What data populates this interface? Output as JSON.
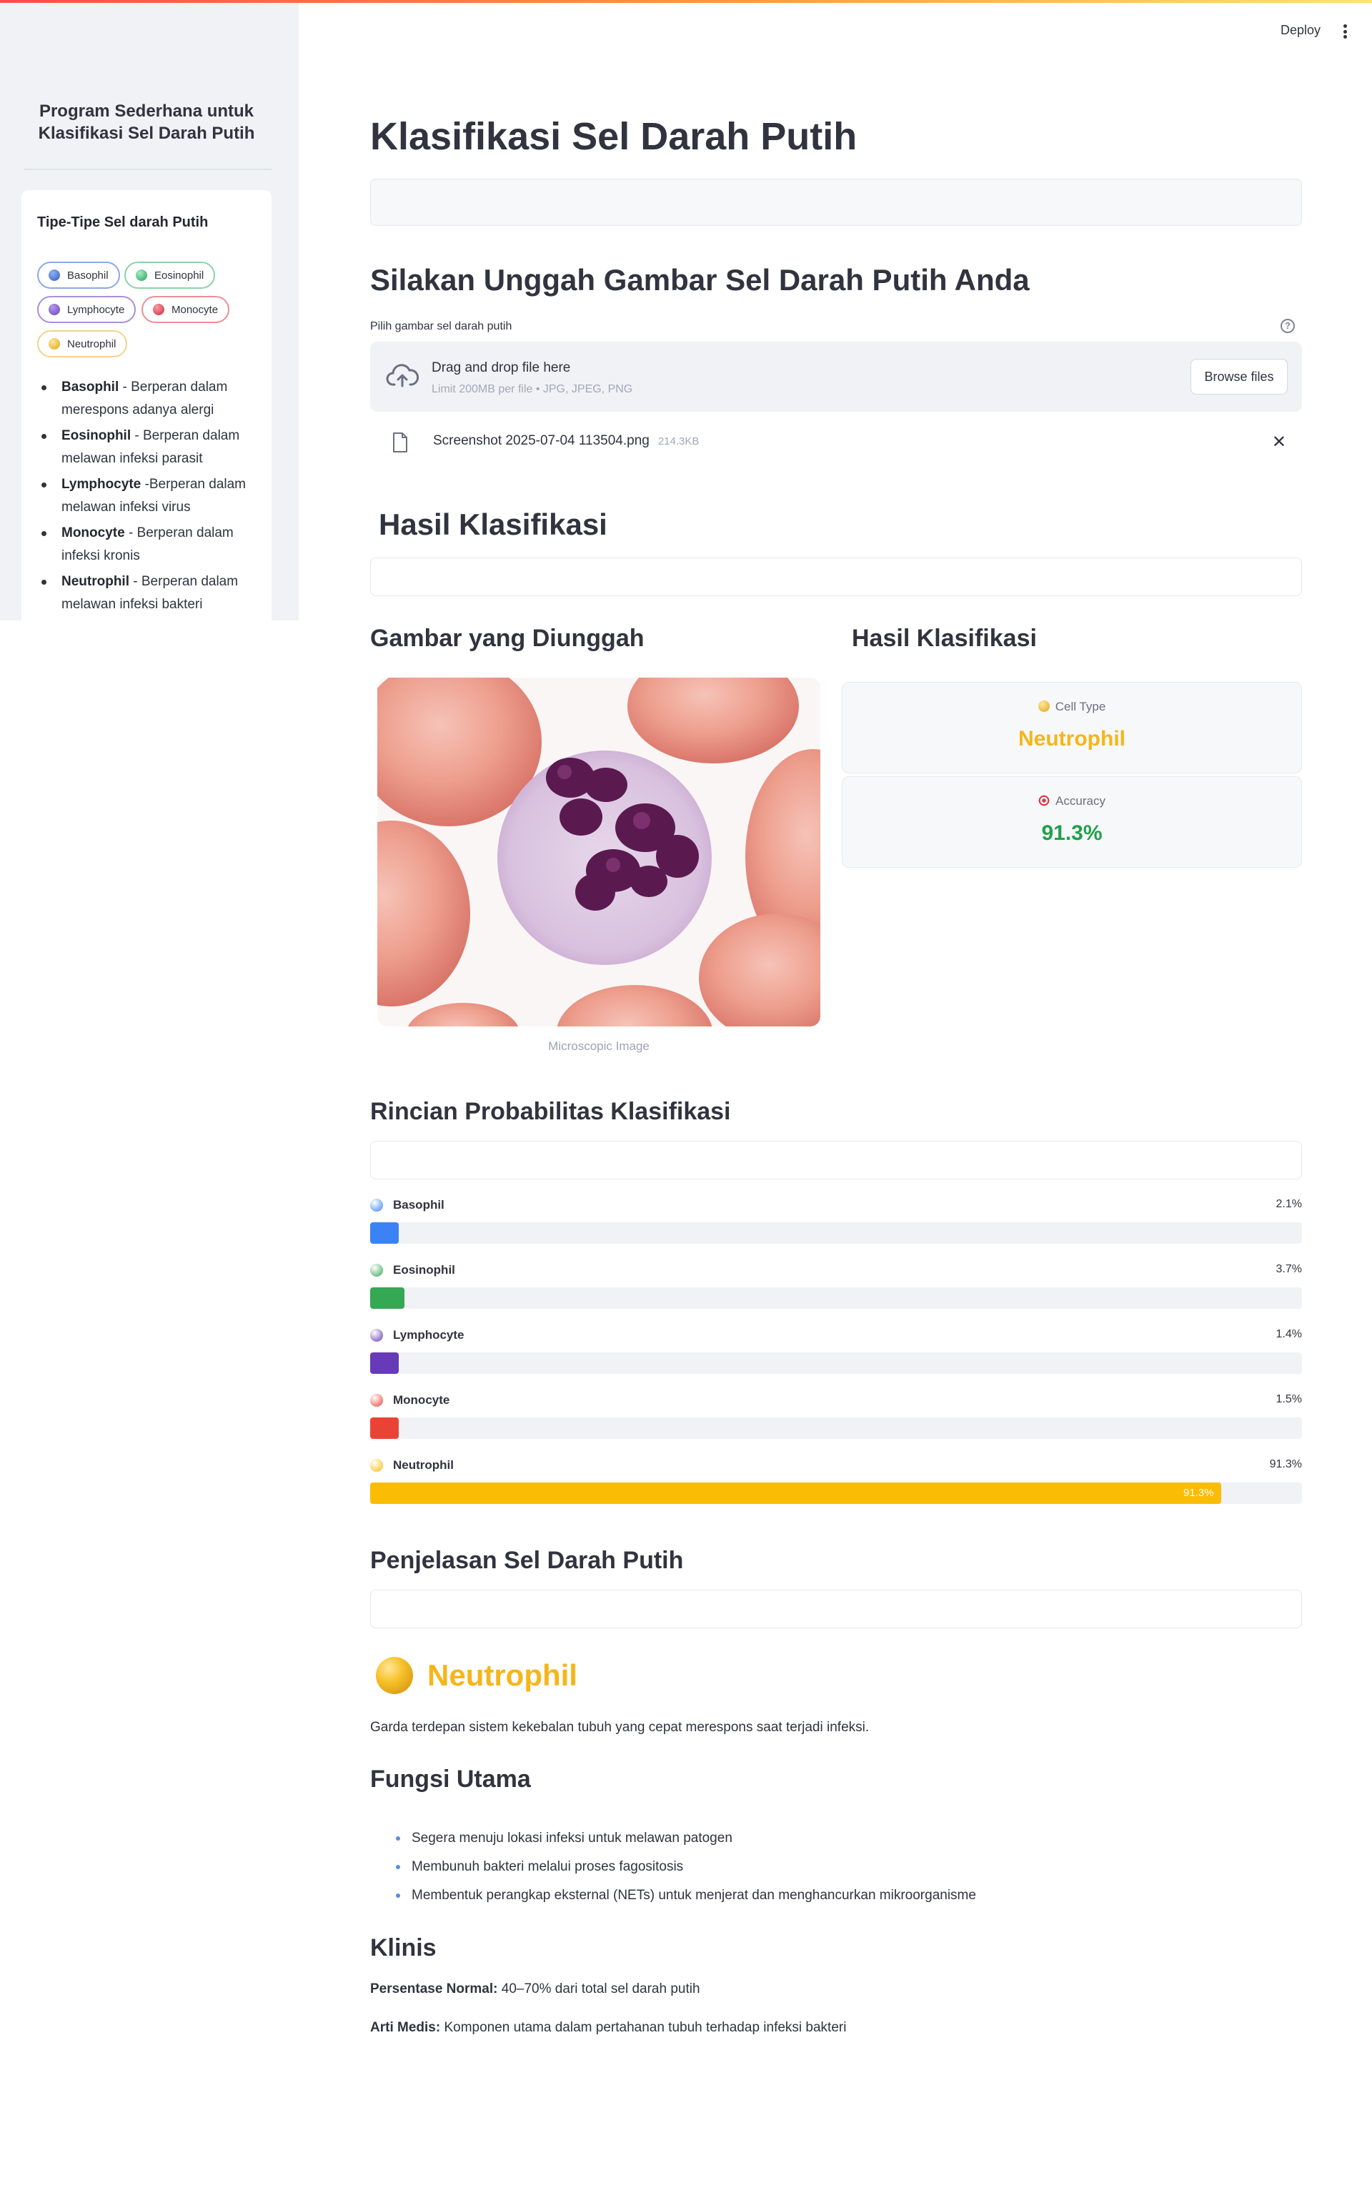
{
  "header": {
    "deploy_label": "Deploy"
  },
  "sidebar": {
    "title": "Program Sederhana untuk Klasifikasi Sel Darah Putih",
    "card_title": "Tipe-Tipe Sel darah Putih",
    "chips": [
      {
        "label": "Basophil",
        "color": "#3b6fd4"
      },
      {
        "label": "Eosinophil",
        "color": "#2fb36b"
      },
      {
        "label": "Lymphocyte",
        "color": "#7b4fc9"
      },
      {
        "label": "Monocyte",
        "color": "#e0394a"
      },
      {
        "label": "Neutrophil",
        "color": "#f2b61e"
      }
    ],
    "descriptions": [
      {
        "name": "Basophil",
        "text": " - Berperan dalam merespons adanya alergi"
      },
      {
        "name": "Eosinophil",
        "text": " - Berperan dalam melawan infeksi parasit"
      },
      {
        "name": "Lymphocyte",
        "text": " -Berperan dalam melawan infeksi virus"
      },
      {
        "name": "Monocyte",
        "text": " - Berperan dalam infeksi kronis"
      },
      {
        "name": "Neutrophil",
        "text": " - Berperan dalam melawan infeksi bakteri"
      }
    ]
  },
  "main": {
    "title": "Klasifikasi Sel Darah Putih",
    "upload": {
      "heading": "Silakan Unggah Gambar Sel Darah Putih Anda",
      "label": "Pilih gambar sel darah putih",
      "drop_text": "Drag and drop file here",
      "limit_text": "Limit 200MB per file • JPG, JPEG, PNG",
      "browse_label": "Browse files",
      "file_name": "Screenshot 2025-07-04 113504.png",
      "file_size": "214.3KB"
    },
    "results": {
      "heading": "Hasil Klasifikasi",
      "image_heading": "Gambar yang Diunggah",
      "result_heading": "Hasil Klasifikasi",
      "image_caption": "Microscopic Image",
      "cell_type_label": "Cell Type",
      "cell_type_value": "Neutrophil",
      "accuracy_label": "Accuracy",
      "accuracy_value": "91.3%"
    },
    "probabilities": {
      "heading": "Rincian Probabilitas Klasifikasi",
      "items": [
        {
          "name": "Basophil",
          "percent_text": "2.1%",
          "value": 2.1,
          "color": "#3b82f6"
        },
        {
          "name": "Eosinophil",
          "percent_text": "3.7%",
          "value": 3.7,
          "color": "#34a853"
        },
        {
          "name": "Lymphocyte",
          "percent_text": "1.4%",
          "value": 1.4,
          "color": "#673ab7"
        },
        {
          "name": "Monocyte",
          "percent_text": "1.5%",
          "value": 1.5,
          "color": "#ea4335"
        },
        {
          "name": "Neutrophil",
          "percent_text": "91.3%",
          "value": 91.3,
          "color": "#fbbc04",
          "bar_label": "91.3%"
        }
      ]
    },
    "explanation": {
      "heading": "Penjelasan Sel Darah Putih",
      "cell_name": "Neutrophil",
      "summary": "Garda terdepan sistem kekebalan tubuh yang cepat merespons saat terjadi infeksi.",
      "functions_heading": "Fungsi Utama",
      "functions": [
        "Segera menuju lokasi infeksi untuk melawan patogen",
        "Membunuh bakteri melalui proses fagositosis",
        "Membentuk perangkap eksternal (NETs) untuk menjerat dan menghancurkan mikroorganisme"
      ],
      "clinical_heading": "Klinis",
      "normal_label": "Persentase Normal:",
      "normal_value": " 40–70% dari total sel darah putih",
      "medical_label": "Arti Medis:",
      "medical_value": " Komponen utama dalam pertahanan tubuh terhadap infeksi bakteri"
    }
  }
}
